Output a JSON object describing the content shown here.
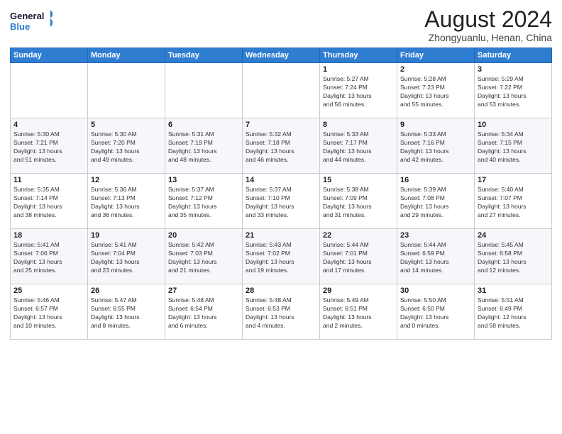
{
  "logo": {
    "line1": "General",
    "line2": "Blue"
  },
  "title": "August 2024",
  "subtitle": "Zhongyuanlu, Henan, China",
  "weekdays": [
    "Sunday",
    "Monday",
    "Tuesday",
    "Wednesday",
    "Thursday",
    "Friday",
    "Saturday"
  ],
  "weeks": [
    [
      {
        "day": "",
        "info": ""
      },
      {
        "day": "",
        "info": ""
      },
      {
        "day": "",
        "info": ""
      },
      {
        "day": "",
        "info": ""
      },
      {
        "day": "1",
        "info": "Sunrise: 5:27 AM\nSunset: 7:24 PM\nDaylight: 13 hours\nand 56 minutes."
      },
      {
        "day": "2",
        "info": "Sunrise: 5:28 AM\nSunset: 7:23 PM\nDaylight: 13 hours\nand 55 minutes."
      },
      {
        "day": "3",
        "info": "Sunrise: 5:29 AM\nSunset: 7:22 PM\nDaylight: 13 hours\nand 53 minutes."
      }
    ],
    [
      {
        "day": "4",
        "info": "Sunrise: 5:30 AM\nSunset: 7:21 PM\nDaylight: 13 hours\nand 51 minutes."
      },
      {
        "day": "5",
        "info": "Sunrise: 5:30 AM\nSunset: 7:20 PM\nDaylight: 13 hours\nand 49 minutes."
      },
      {
        "day": "6",
        "info": "Sunrise: 5:31 AM\nSunset: 7:19 PM\nDaylight: 13 hours\nand 48 minutes."
      },
      {
        "day": "7",
        "info": "Sunrise: 5:32 AM\nSunset: 7:18 PM\nDaylight: 13 hours\nand 46 minutes."
      },
      {
        "day": "8",
        "info": "Sunrise: 5:33 AM\nSunset: 7:17 PM\nDaylight: 13 hours\nand 44 minutes."
      },
      {
        "day": "9",
        "info": "Sunrise: 5:33 AM\nSunset: 7:16 PM\nDaylight: 13 hours\nand 42 minutes."
      },
      {
        "day": "10",
        "info": "Sunrise: 5:34 AM\nSunset: 7:15 PM\nDaylight: 13 hours\nand 40 minutes."
      }
    ],
    [
      {
        "day": "11",
        "info": "Sunrise: 5:35 AM\nSunset: 7:14 PM\nDaylight: 13 hours\nand 38 minutes."
      },
      {
        "day": "12",
        "info": "Sunrise: 5:36 AM\nSunset: 7:13 PM\nDaylight: 13 hours\nand 36 minutes."
      },
      {
        "day": "13",
        "info": "Sunrise: 5:37 AM\nSunset: 7:12 PM\nDaylight: 13 hours\nand 35 minutes."
      },
      {
        "day": "14",
        "info": "Sunrise: 5:37 AM\nSunset: 7:10 PM\nDaylight: 13 hours\nand 33 minutes."
      },
      {
        "day": "15",
        "info": "Sunrise: 5:38 AM\nSunset: 7:09 PM\nDaylight: 13 hours\nand 31 minutes."
      },
      {
        "day": "16",
        "info": "Sunrise: 5:39 AM\nSunset: 7:08 PM\nDaylight: 13 hours\nand 29 minutes."
      },
      {
        "day": "17",
        "info": "Sunrise: 5:40 AM\nSunset: 7:07 PM\nDaylight: 13 hours\nand 27 minutes."
      }
    ],
    [
      {
        "day": "18",
        "info": "Sunrise: 5:41 AM\nSunset: 7:06 PM\nDaylight: 13 hours\nand 25 minutes."
      },
      {
        "day": "19",
        "info": "Sunrise: 5:41 AM\nSunset: 7:04 PM\nDaylight: 13 hours\nand 23 minutes."
      },
      {
        "day": "20",
        "info": "Sunrise: 5:42 AM\nSunset: 7:03 PM\nDaylight: 13 hours\nand 21 minutes."
      },
      {
        "day": "21",
        "info": "Sunrise: 5:43 AM\nSunset: 7:02 PM\nDaylight: 13 hours\nand 19 minutes."
      },
      {
        "day": "22",
        "info": "Sunrise: 5:44 AM\nSunset: 7:01 PM\nDaylight: 13 hours\nand 17 minutes."
      },
      {
        "day": "23",
        "info": "Sunrise: 5:44 AM\nSunset: 6:59 PM\nDaylight: 13 hours\nand 14 minutes."
      },
      {
        "day": "24",
        "info": "Sunrise: 5:45 AM\nSunset: 6:58 PM\nDaylight: 13 hours\nand 12 minutes."
      }
    ],
    [
      {
        "day": "25",
        "info": "Sunrise: 5:46 AM\nSunset: 6:57 PM\nDaylight: 13 hours\nand 10 minutes."
      },
      {
        "day": "26",
        "info": "Sunrise: 5:47 AM\nSunset: 6:55 PM\nDaylight: 13 hours\nand 8 minutes."
      },
      {
        "day": "27",
        "info": "Sunrise: 5:48 AM\nSunset: 6:54 PM\nDaylight: 13 hours\nand 6 minutes."
      },
      {
        "day": "28",
        "info": "Sunrise: 5:48 AM\nSunset: 6:53 PM\nDaylight: 13 hours\nand 4 minutes."
      },
      {
        "day": "29",
        "info": "Sunrise: 5:49 AM\nSunset: 6:51 PM\nDaylight: 13 hours\nand 2 minutes."
      },
      {
        "day": "30",
        "info": "Sunrise: 5:50 AM\nSunset: 6:50 PM\nDaylight: 13 hours\nand 0 minutes."
      },
      {
        "day": "31",
        "info": "Sunrise: 5:51 AM\nSunset: 6:49 PM\nDaylight: 12 hours\nand 58 minutes."
      }
    ]
  ]
}
